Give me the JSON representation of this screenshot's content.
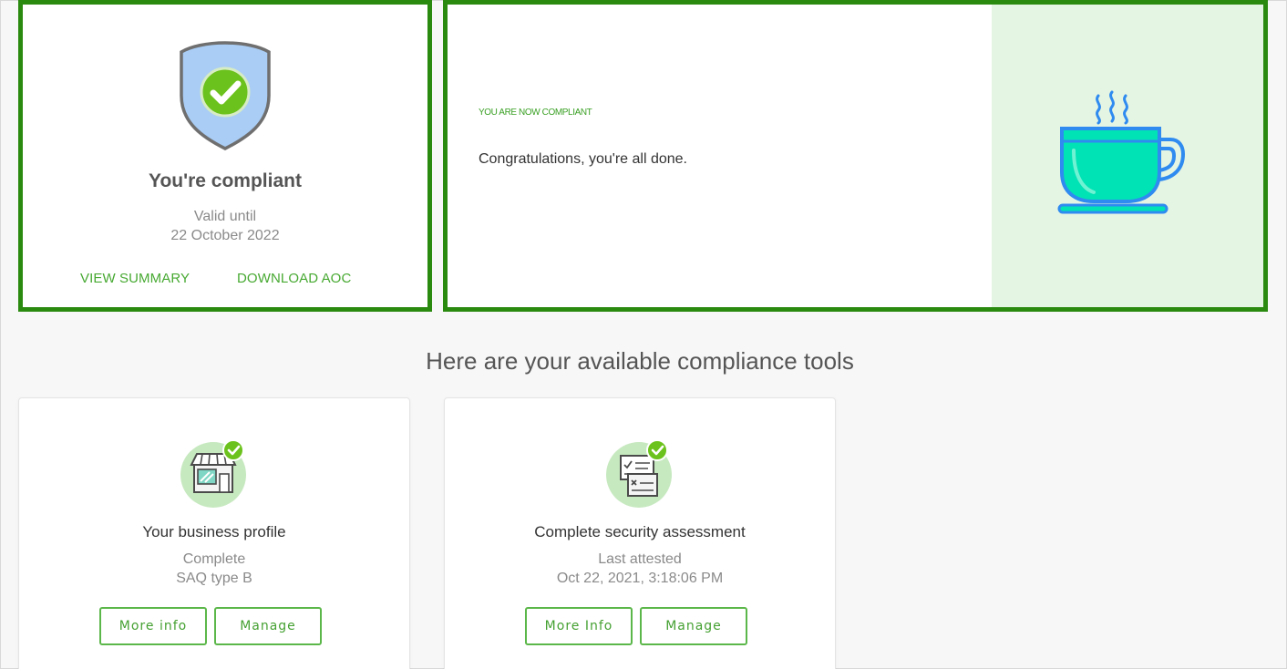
{
  "status_card": {
    "icon": "shield-check-icon",
    "title": "You're compliant",
    "valid_label": "Valid until",
    "valid_date": "22 October 2022",
    "view_summary": "VIEW SUMMARY",
    "download_aoc": "DOWNLOAD AOC"
  },
  "message_card": {
    "eyebrow": "YOU ARE NOW COMPLIANT",
    "text": "Congratulations, you're all done.",
    "illustration": "coffee-cup-icon"
  },
  "tools_heading": "Here are your available compliance tools",
  "tools": [
    {
      "icon": "storefront-check-icon",
      "title": "Your business profile",
      "line1": "Complete",
      "line2": "SAQ type B",
      "info_label": "More info",
      "manage_label": "Manage"
    },
    {
      "icon": "checklist-check-icon",
      "title": "Complete security assessment",
      "line1": "Last attested",
      "line2": "Oct 22, 2021, 3:18:06 PM",
      "info_label": "More Info",
      "manage_label": "Manage"
    }
  ],
  "colors": {
    "highlight_border": "#2a8a10",
    "accent_green": "#47a932",
    "illustration_bg": "#e5f5e3",
    "cup_teal": "#00e3b4",
    "cup_outline": "#2f8bf0"
  }
}
